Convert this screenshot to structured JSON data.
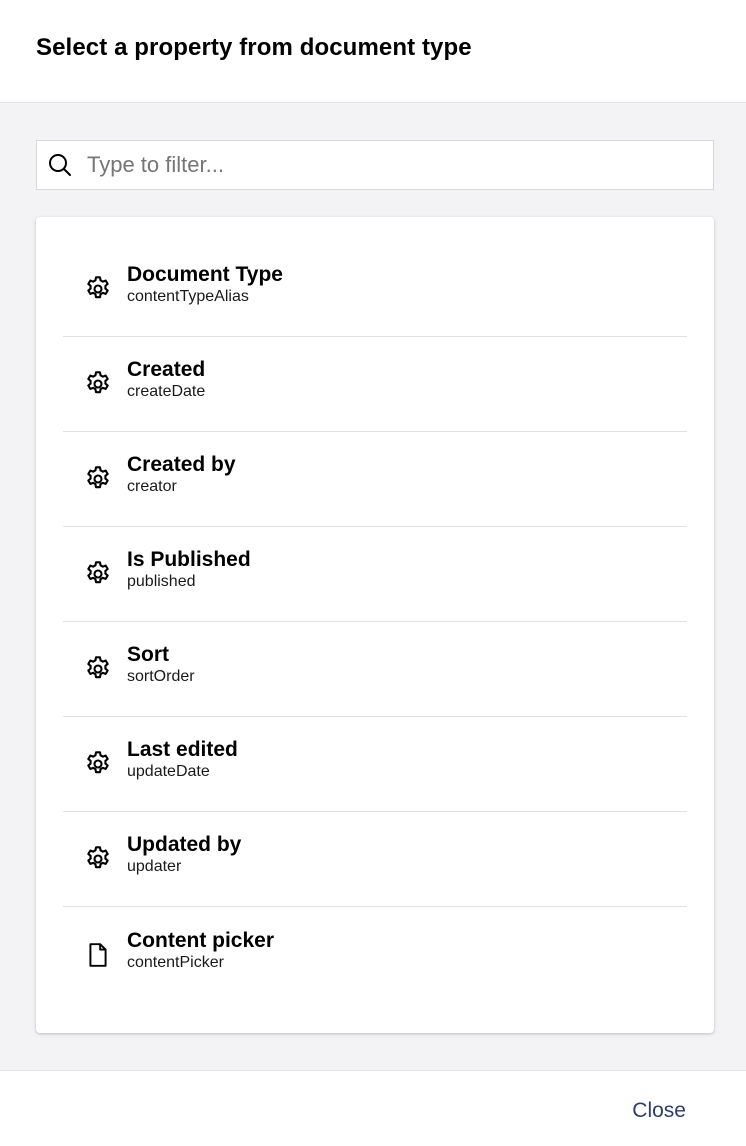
{
  "header": {
    "title": "Select a property from document type"
  },
  "search": {
    "placeholder": "Type to filter...",
    "value": ""
  },
  "items": [
    {
      "name": "Document Type",
      "alias": "contentTypeAlias",
      "icon": "gear-icon"
    },
    {
      "name": "Created",
      "alias": "createDate",
      "icon": "gear-icon"
    },
    {
      "name": "Created by",
      "alias": "creator",
      "icon": "gear-icon"
    },
    {
      "name": "Is Published",
      "alias": "published",
      "icon": "gear-icon"
    },
    {
      "name": "Sort",
      "alias": "sortOrder",
      "icon": "gear-icon"
    },
    {
      "name": "Last edited",
      "alias": "updateDate",
      "icon": "gear-icon"
    },
    {
      "name": "Updated by",
      "alias": "updater",
      "icon": "gear-icon"
    },
    {
      "name": "Content picker",
      "alias": "contentPicker",
      "icon": "document-icon"
    }
  ],
  "footer": {
    "close_label": "Close"
  },
  "colors": {
    "close_text": "#2c3e6b",
    "body_background": "#f3f3f5"
  }
}
